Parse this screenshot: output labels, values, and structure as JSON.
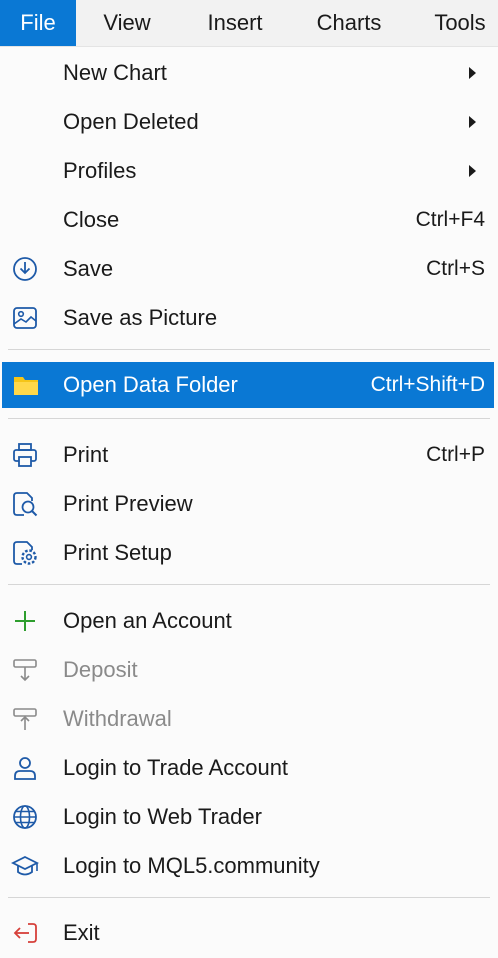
{
  "menubar": {
    "items": [
      {
        "label": "File"
      },
      {
        "label": "View"
      },
      {
        "label": "Insert"
      },
      {
        "label": "Charts"
      },
      {
        "label": "Tools"
      }
    ]
  },
  "menu": {
    "items": [
      {
        "label": "New Chart",
        "submenu": true
      },
      {
        "label": "Open Deleted",
        "submenu": true
      },
      {
        "label": "Profiles",
        "submenu": true
      },
      {
        "label": "Close",
        "shortcut": "Ctrl+F4"
      },
      {
        "label": "Save",
        "shortcut": "Ctrl+S",
        "icon": "save-icon"
      },
      {
        "label": "Save as Picture",
        "icon": "picture-icon"
      },
      {
        "label": "Open Data Folder",
        "shortcut": "Ctrl+Shift+D",
        "icon": "folder-icon",
        "highlighted": true
      },
      {
        "label": "Print",
        "shortcut": "Ctrl+P",
        "icon": "printer-icon"
      },
      {
        "label": "Print Preview",
        "icon": "print-preview-icon"
      },
      {
        "label": "Print Setup",
        "icon": "print-setup-icon"
      },
      {
        "label": "Open an Account",
        "icon": "plus-icon"
      },
      {
        "label": "Deposit",
        "icon": "deposit-icon",
        "disabled": true
      },
      {
        "label": "Withdrawal",
        "icon": "withdrawal-icon",
        "disabled": true
      },
      {
        "label": "Login to Trade Account",
        "icon": "user-icon"
      },
      {
        "label": "Login to Web Trader",
        "icon": "globe-icon"
      },
      {
        "label": "Login to MQL5.community",
        "icon": "graduation-cap-icon"
      },
      {
        "label": "Exit",
        "icon": "exit-icon"
      }
    ]
  },
  "colors": {
    "accent": "#0a78d4",
    "folder": "#f5c518",
    "plus": "#2e9e2e",
    "exit": "#d6403a",
    "disabled": "#8a8a8a"
  }
}
